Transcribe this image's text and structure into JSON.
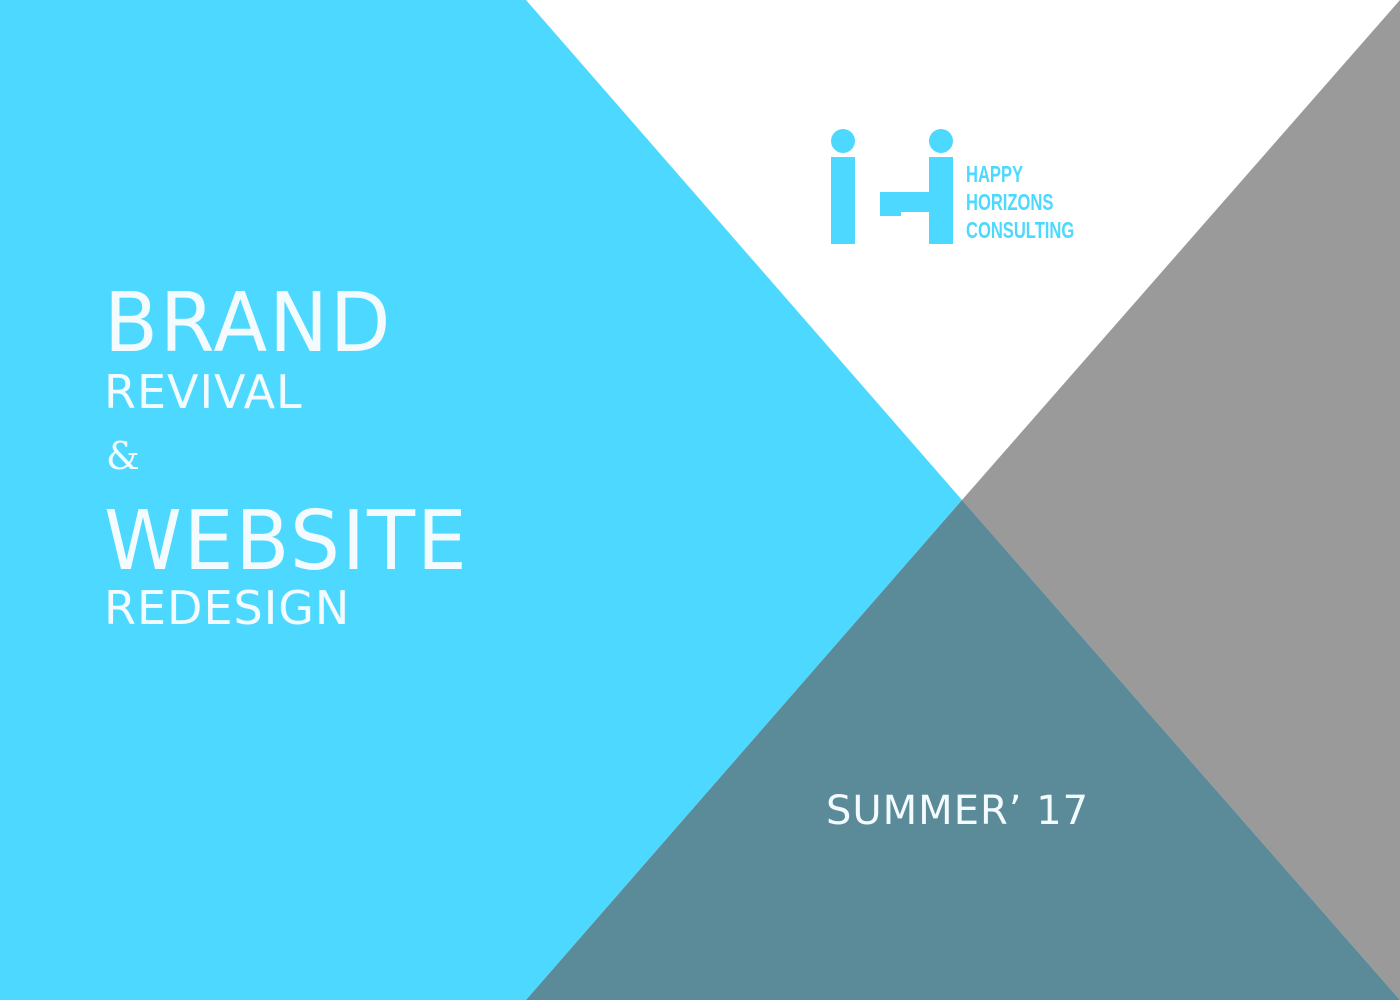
{
  "logo": {
    "icon": "ih-logo-icon",
    "lines": [
      "HAPPY",
      "HORIZONS",
      "CONSULTING"
    ]
  },
  "title": {
    "line1": "BRAND",
    "line2": "REVIVAL",
    "line3": "&",
    "line4": "WEBSITE",
    "line5": "REDESIGN"
  },
  "season": "SUMMER’ 17",
  "colors": {
    "cyan": "#4dd9ff",
    "gray": "#9a9a9a",
    "teal": "#5b8b99",
    "white": "#ffffff",
    "text": "#f3fbfe"
  }
}
